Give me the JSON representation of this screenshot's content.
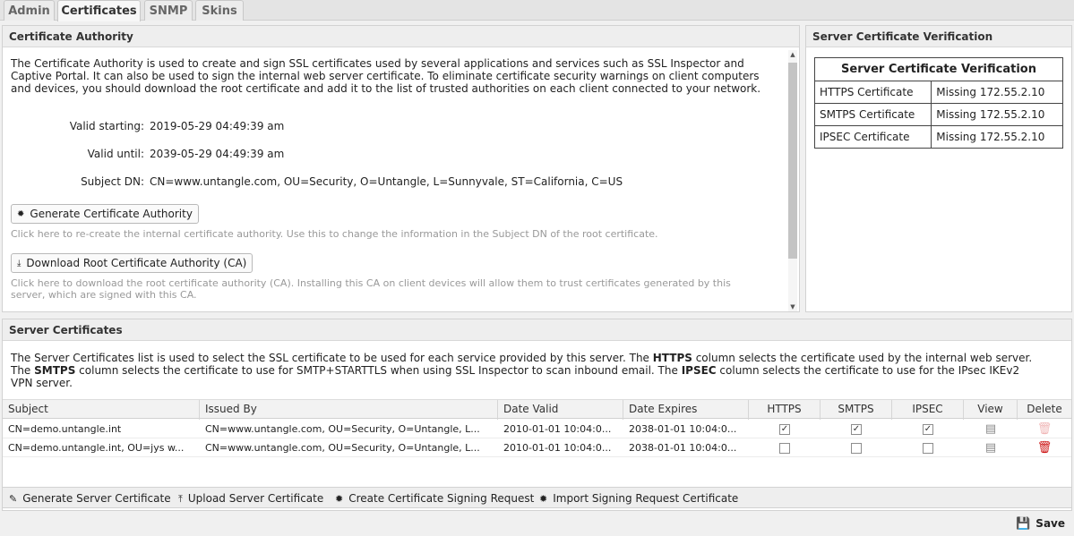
{
  "tabs": [
    {
      "label": "Admin"
    },
    {
      "label": "Certificates"
    },
    {
      "label": "SNMP"
    },
    {
      "label": "Skins"
    }
  ],
  "ca": {
    "title": "Certificate Authority",
    "description": "The Certificate Authority is used to create and sign SSL certificates used by several applications and services such as SSL Inspector and Captive Portal. It can also be used to sign the internal web server certificate. To eliminate certificate security warnings on client computers and devices, you should download the root certificate and add it to the list of trusted authorities on each client connected to your network.",
    "valid_starting_label": "Valid starting:",
    "valid_starting": "2019-05-29 04:49:39 am",
    "valid_until_label": "Valid until:",
    "valid_until": "2039-05-29 04:49:39 am",
    "subject_dn_label": "Subject DN:",
    "subject_dn": "CN=www.untangle.com, OU=Security, O=Untangle, L=Sunnyvale, ST=California, C=US",
    "generate_label": "Generate Certificate Authority",
    "generate_help": "Click here to re-create the internal certificate authority. Use this to change the information in the Subject DN of the root certificate.",
    "download_label": "Download Root Certificate Authority (CA)",
    "download_help": "Click here to download the root certificate authority (CA). Installing this CA on client devices will allow them to trust certificates generated by this server, which are signed with this CA."
  },
  "verification": {
    "title": "Server Certificate Verification",
    "table_title": "Server Certificate Verification",
    "rows": [
      {
        "name": "HTTPS Certificate",
        "status": "Missing 172.55.2.10"
      },
      {
        "name": "SMTPS Certificate",
        "status": "Missing 172.55.2.10"
      },
      {
        "name": "IPSEC Certificate",
        "status": "Missing 172.55.2.10"
      }
    ]
  },
  "server_certs": {
    "title": "Server Certificates",
    "desc_1": "The Server Certificates list is used to select the SSL certificate to be used for each service provided by this server. The ",
    "desc_https": "HTTPS",
    "desc_2": " column selects the certificate used by the internal web server. The ",
    "desc_smtps": "SMTPS",
    "desc_3": " column selects the certificate to use for SMTP+STARTTLS when using SSL Inspector to scan inbound email. The ",
    "desc_ipsec": "IPSEC",
    "desc_4": " column selects the certificate to use for the IPsec IKEv2 VPN server.",
    "columns": {
      "subject": "Subject",
      "issued_by": "Issued By",
      "date_valid": "Date Valid",
      "date_expires": "Date Expires",
      "https": "HTTPS",
      "smtps": "SMTPS",
      "ipsec": "IPSEC",
      "view": "View",
      "delete": "Delete"
    },
    "rows": [
      {
        "subject": "CN=demo.untangle.int",
        "issued_by": "CN=www.untangle.com, OU=Security, O=Untangle, L...",
        "date_valid": "2010-01-01 10:04:0...",
        "date_expires": "2038-01-01 10:04:0...",
        "https": "✓",
        "smtps": "✓",
        "ipsec": "✓"
      },
      {
        "subject": "CN=demo.untangle.int, OU=jys w...",
        "issued_by": "CN=www.untangle.com, OU=Security, O=Untangle, L...",
        "date_valid": "2010-01-01 10:04:0...",
        "date_expires": "2038-01-01 10:04:0...",
        "https": "",
        "smtps": "",
        "ipsec": ""
      }
    ]
  },
  "toolbar": {
    "generate": "Generate Server Certificate",
    "upload": "Upload Server Certificate",
    "csr": "Create Certificate Signing Request",
    "import": "Import Signing Request Certificate"
  },
  "save_label": "Save",
  "colors": {
    "delete_active": "#cc1111",
    "delete_disabled": "#f0b7b7"
  }
}
